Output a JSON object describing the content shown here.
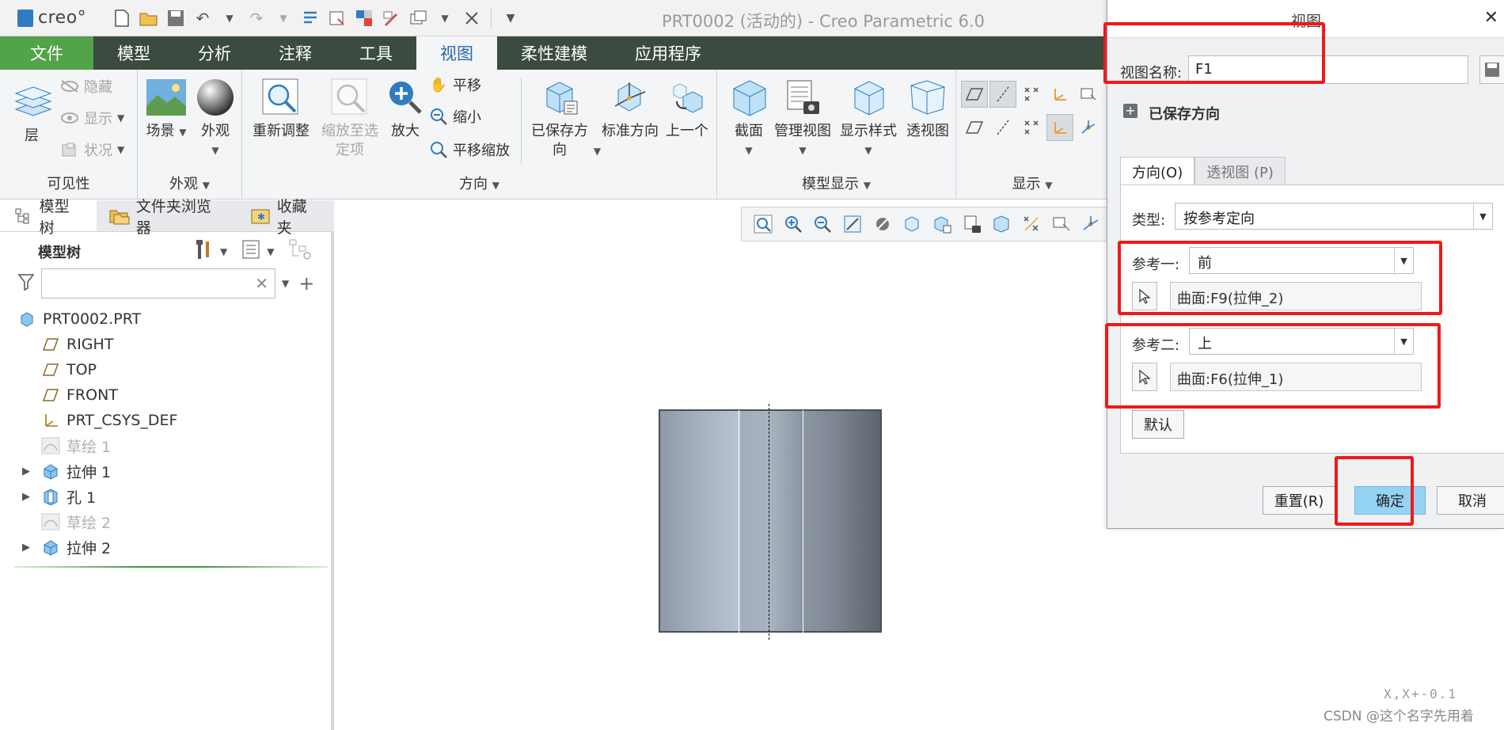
{
  "app": {
    "logo": "creo°",
    "title": "PRT0002 (活动的) - Creo Parametric 6.0"
  },
  "quick_access": [
    "new-icon",
    "open-icon",
    "save-icon",
    "undo-icon",
    "redo-icon",
    "regenerate-icon",
    "windows-icon",
    "close-icon"
  ],
  "ribbon_tabs": [
    {
      "label": "文件",
      "active": false
    },
    {
      "label": "模型",
      "active": false
    },
    {
      "label": "分析",
      "active": false
    },
    {
      "label": "注释",
      "active": false
    },
    {
      "label": "工具",
      "active": false
    },
    {
      "label": "视图",
      "active": true
    },
    {
      "label": "柔性建模",
      "active": false
    },
    {
      "label": "应用程序",
      "active": false
    }
  ],
  "ribbon": {
    "visibility": {
      "title": "可见性",
      "layer": "层",
      "hide": "隐藏",
      "show": "显示",
      "status": "状况"
    },
    "appearance": {
      "title": "外观",
      "scene": "场景",
      "appearance": "外观"
    },
    "orientation": {
      "title": "方向",
      "refit": "重新调整",
      "zoom_to_selected": "缩放至选定项",
      "zoom_in": "放大",
      "pan": "平移",
      "zoom_out": "缩小",
      "pan_zoom": "平移缩放",
      "saved_orientations": "已保存方向",
      "standard_orientation": "标准方向",
      "previous": "上一个"
    },
    "model_display": {
      "title": "模型显示",
      "section": "截面",
      "manage_views": "管理视图",
      "display_style": "显示样式",
      "perspective": "透视图"
    },
    "display": {
      "title": "显示"
    }
  },
  "left_panel": {
    "tabs": [
      {
        "label": "模型树",
        "active": true
      },
      {
        "label": "文件夹浏览器",
        "active": false
      },
      {
        "label": "收藏夹",
        "active": false
      }
    ],
    "tree_header": "模型树",
    "search_value": "",
    "tree": [
      {
        "label": "PRT0002.PRT",
        "icon": "part-icon",
        "level": 0,
        "expandable": false,
        "disabled": false
      },
      {
        "label": "RIGHT",
        "icon": "datum-plane-icon",
        "level": 1,
        "expandable": false,
        "disabled": false
      },
      {
        "label": "TOP",
        "icon": "datum-plane-icon",
        "level": 1,
        "expandable": false,
        "disabled": false
      },
      {
        "label": "FRONT",
        "icon": "datum-plane-icon",
        "level": 1,
        "expandable": false,
        "disabled": false
      },
      {
        "label": "PRT_CSYS_DEF",
        "icon": "csys-icon",
        "level": 1,
        "expandable": false,
        "disabled": false
      },
      {
        "label": "草绘 1",
        "icon": "sketch-icon",
        "level": 1,
        "expandable": false,
        "disabled": true
      },
      {
        "label": "拉伸 1",
        "icon": "extrude-icon",
        "level": 1,
        "expandable": true,
        "disabled": false
      },
      {
        "label": "孔 1",
        "icon": "hole-icon",
        "level": 1,
        "expandable": true,
        "disabled": false
      },
      {
        "label": "草绘 2",
        "icon": "sketch-icon",
        "level": 1,
        "expandable": false,
        "disabled": true
      },
      {
        "label": "拉伸 2",
        "icon": "extrude-icon",
        "level": 1,
        "expandable": true,
        "disabled": false
      }
    ]
  },
  "graphics": {
    "coord_text": "X,X+-0.1"
  },
  "dialog": {
    "title": "视图",
    "view_name_label": "视图名称:",
    "view_name_value": "F1",
    "saved_orientations": "已保存方向",
    "tabs": [
      {
        "label": "方向(O)",
        "active": true
      },
      {
        "label": "透视图 (P)",
        "active": false
      }
    ],
    "type_label": "类型:",
    "type_value": "按参考定向",
    "ref1_label": "参考一:",
    "ref1_value": "前",
    "ref1_surface": "曲面:F9(拉伸_2)",
    "ref2_label": "参考二:",
    "ref2_value": "上",
    "ref2_surface": "曲面:F6(拉伸_1)",
    "default_button": "默认",
    "reset_button": "重置(R)",
    "ok_button": "确定",
    "cancel_button": "取消"
  },
  "watermark": "CSDN @这个名字先用着",
  "colors": {
    "ribbon_tab_bg": "#3b4b3f",
    "file_tab_bg": "#52a34a",
    "active_tab_text": "#2a6aa8",
    "annotation_red": "#f21818",
    "ok_button_bg": "#96d3f3"
  }
}
